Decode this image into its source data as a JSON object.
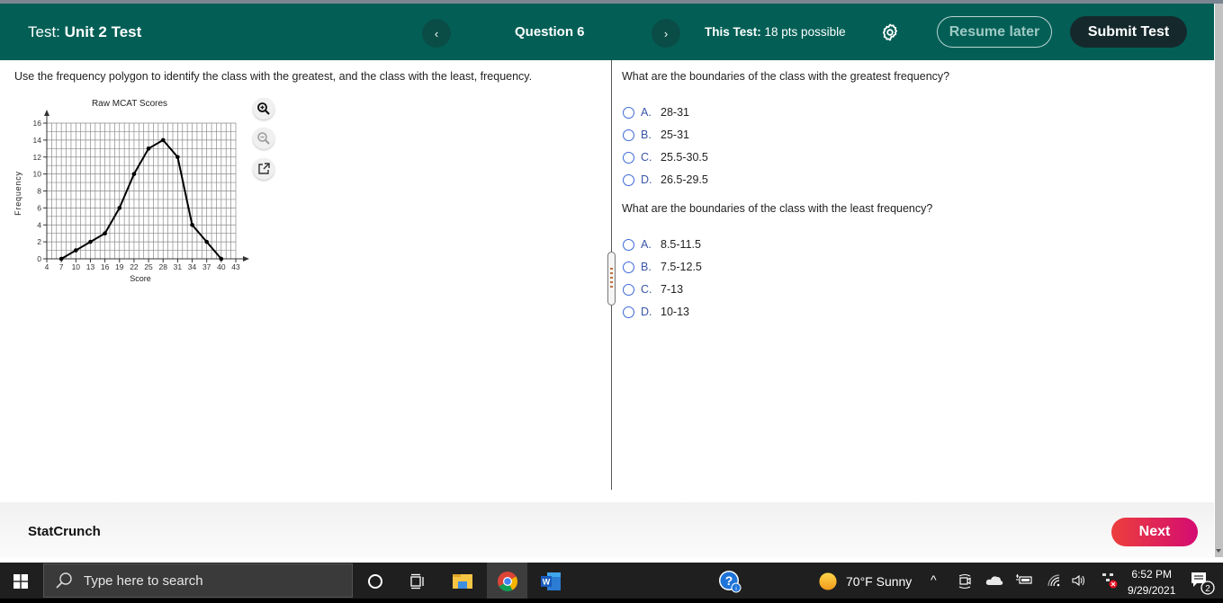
{
  "header": {
    "test_prefix": "Test:",
    "test_name": "Unit 2 Test",
    "prev_label": "‹",
    "question_label": "Question 6",
    "next_label": "›",
    "points_prefix": "This Test:",
    "points_text": "18 pts possible",
    "resume_label": "Resume later",
    "submit_label": "Submit Test",
    "colors": {
      "bar": "#035f56",
      "submit": "#15292d"
    }
  },
  "left_panel": {
    "instruction": "Use the frequency polygon to identify the class with the greatest, and the class with the least, frequency.",
    "tools": [
      "zoom-in-icon",
      "zoom-out-icon",
      "open-external-icon"
    ]
  },
  "chart_data": {
    "type": "line",
    "title": "Raw MCAT Scores",
    "xlabel": "Score",
    "ylabel": "Frequency",
    "x_ticks": [
      4,
      7,
      10,
      13,
      16,
      19,
      22,
      25,
      28,
      31,
      34,
      37,
      40,
      43
    ],
    "y_ticks": [
      0,
      2,
      4,
      6,
      8,
      10,
      12,
      14,
      16
    ],
    "xlim": [
      4,
      43
    ],
    "ylim": [
      0,
      16
    ],
    "grid": true,
    "x": [
      7,
      10,
      13,
      16,
      19,
      22,
      25,
      28,
      31,
      34,
      37,
      40
    ],
    "series": [
      {
        "name": "Frequency",
        "values": [
          0,
          1,
          2,
          3,
          6,
          10,
          13,
          14,
          12,
          4,
          2,
          0
        ]
      }
    ]
  },
  "right_panel": {
    "q1": {
      "text": "What are the boundaries of the class with the greatest frequency?",
      "options": [
        {
          "letter": "A.",
          "text": "28-31"
        },
        {
          "letter": "B.",
          "text": "25-31"
        },
        {
          "letter": "C.",
          "text": "25.5-30.5"
        },
        {
          "letter": "D.",
          "text": "26.5-29.5"
        }
      ]
    },
    "q2": {
      "text": "What are the boundaries of the class with the least frequency?",
      "options": [
        {
          "letter": "A.",
          "text": "8.5-11.5"
        },
        {
          "letter": "B.",
          "text": "7.5-12.5"
        },
        {
          "letter": "C.",
          "text": "7-13"
        },
        {
          "letter": "D.",
          "text": "10-13"
        }
      ]
    }
  },
  "footer": {
    "statcrunch_label": "StatCrunch",
    "next_label": "Next"
  },
  "taskbar": {
    "search_placeholder": "Type here to search",
    "weather": "70°F  Sunny",
    "time": "6:52 PM",
    "date": "9/29/2021",
    "notification_count": "2"
  }
}
